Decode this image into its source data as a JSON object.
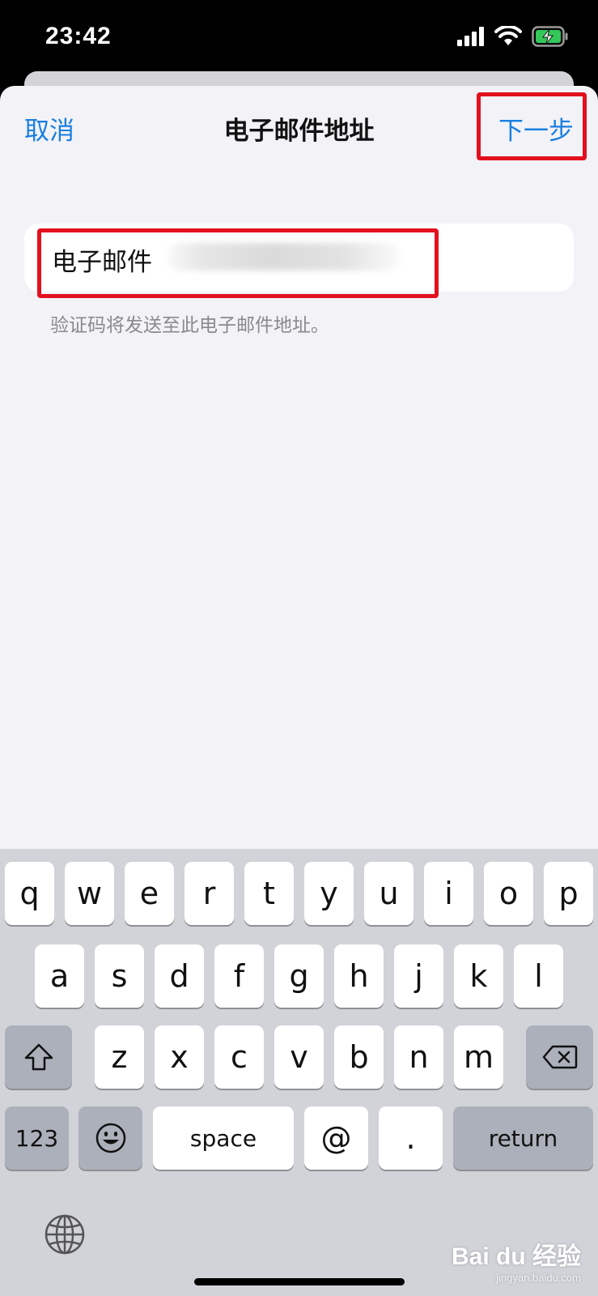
{
  "status_bar": {
    "time": "23:42",
    "signal_icon": "signal-bars-icon",
    "wifi_icon": "wifi-icon",
    "battery_icon": "battery-charging-icon"
  },
  "nav": {
    "cancel_label": "取消",
    "title": "电子邮件地址",
    "next_label": "下一步"
  },
  "form": {
    "email_label": "电子邮件",
    "email_value": "",
    "hint": "验证码将发送至此电子邮件地址。"
  },
  "keyboard": {
    "row1": [
      "q",
      "w",
      "e",
      "r",
      "t",
      "y",
      "u",
      "i",
      "o",
      "p"
    ],
    "row2": [
      "a",
      "s",
      "d",
      "f",
      "g",
      "h",
      "j",
      "k",
      "l"
    ],
    "row3": [
      "z",
      "x",
      "c",
      "v",
      "b",
      "n",
      "m"
    ],
    "numbers_label": "123",
    "space_label": "space",
    "at_label": "@",
    "dot_label": ".",
    "return_label": "return",
    "shift_icon": "shift-icon",
    "delete_icon": "delete-icon",
    "emoji_icon": "emoji-icon",
    "globe_icon": "globe-icon"
  },
  "colors": {
    "accent": "#1a7fe0",
    "highlight": "#e3101e",
    "sheet_bg": "#f2f2f7",
    "keyboard_bg": "#d1d3d9"
  },
  "watermark": {
    "main": "Bai du 经验",
    "sub": "jingyan.baidu.com"
  }
}
